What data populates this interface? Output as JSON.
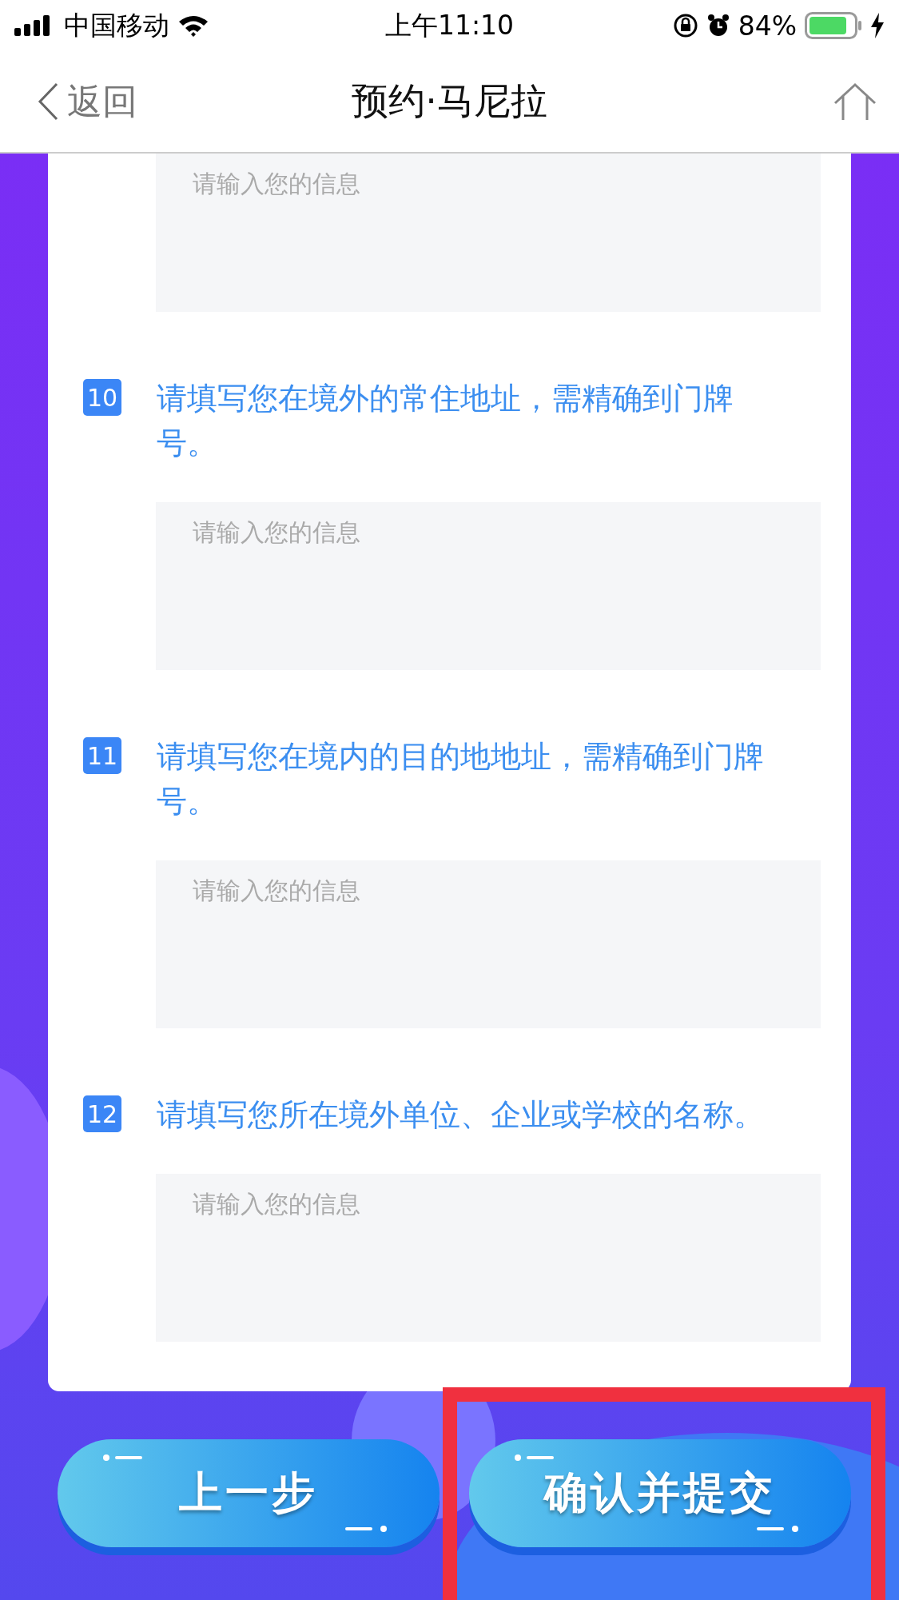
{
  "status_bar": {
    "carrier": "中国移动",
    "time": "上午11:10",
    "battery": "84%"
  },
  "nav": {
    "back": "返回",
    "title": "预约·马尼拉"
  },
  "form": {
    "fields": [
      {
        "placeholder": "请输入您的信息"
      },
      {
        "number": "10",
        "question": "请填写您在境外的常住地址，需精确到门牌号。",
        "placeholder": "请输入您的信息"
      },
      {
        "number": "11",
        "question": "请填写您在境内的目的地地址，需精确到门牌号。",
        "placeholder": "请输入您的信息"
      },
      {
        "number": "12",
        "question": "请填写您所在境外单位、企业或学校的名称。",
        "placeholder": "请输入您的信息"
      }
    ]
  },
  "buttons": [
    {
      "label": "上一步",
      "highlighted": false
    },
    {
      "label": "确认并提交",
      "highlighted": true
    }
  ]
}
